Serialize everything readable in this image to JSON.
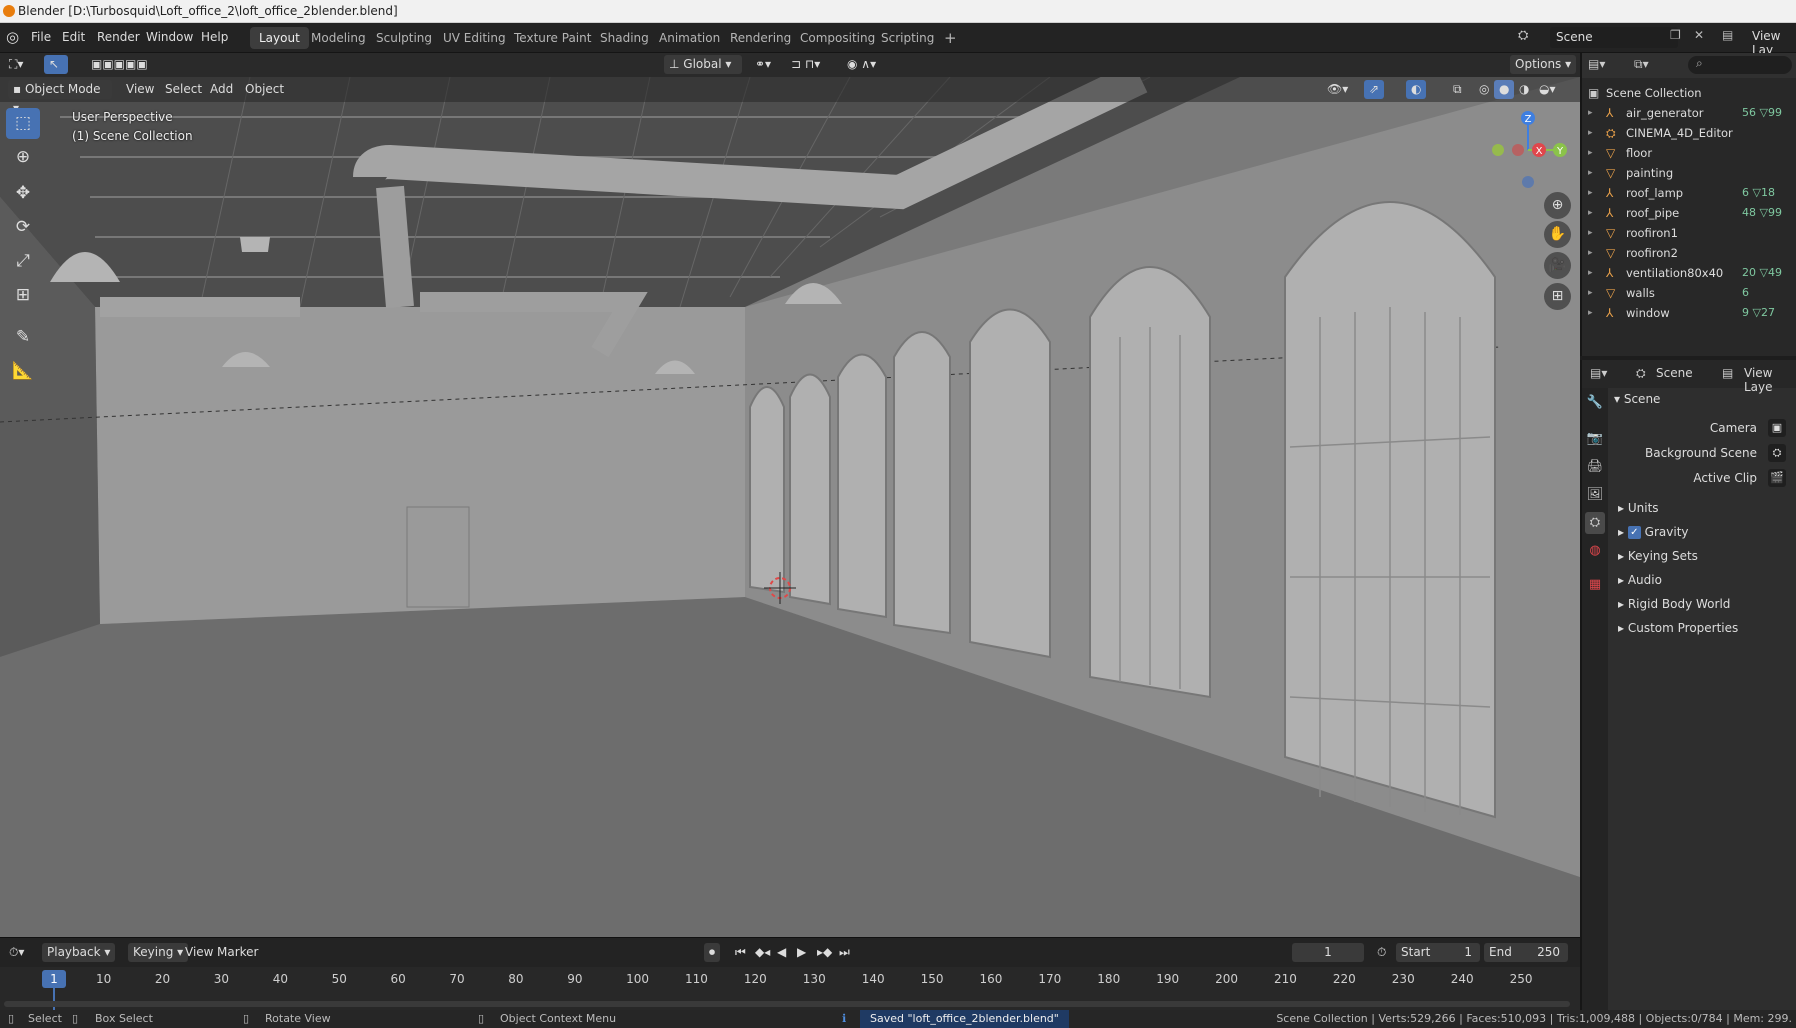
{
  "window": {
    "title": "Blender [D:\\Turbosquid\\Loft_office_2\\loft_office_2blender.blend]"
  },
  "menu": [
    "File",
    "Edit",
    "Render",
    "Window",
    "Help"
  ],
  "workspaces": [
    {
      "label": "Layout",
      "active": true
    },
    {
      "label": "Modeling"
    },
    {
      "label": "Sculpting"
    },
    {
      "label": "UV Editing"
    },
    {
      "label": "Texture Paint"
    },
    {
      "label": "Shading"
    },
    {
      "label": "Animation"
    },
    {
      "label": "Rendering"
    },
    {
      "label": "Compositing"
    },
    {
      "label": "Scripting"
    }
  ],
  "scene_selector": {
    "label": "Scene"
  },
  "view_layer_selector": {
    "label": "View Lay"
  },
  "viewport_header": {
    "orientation": "Global",
    "options": "Options",
    "mode": "Object Mode",
    "menus": [
      "View",
      "Select",
      "Add",
      "Object"
    ]
  },
  "viewport_overlay": {
    "line1": "User Perspective",
    "line2": "(1) Scene Collection"
  },
  "gizmo_axes": {
    "x": "X",
    "y": "Y",
    "z": "Z"
  },
  "outliner": {
    "root": "Scene Collection",
    "items": [
      {
        "name": "air_generator",
        "extra": "56 ▽99"
      },
      {
        "name": "CINEMA_4D_Editor",
        "extra": ""
      },
      {
        "name": "floor",
        "extra": ""
      },
      {
        "name": "painting",
        "extra": ""
      },
      {
        "name": "roof_lamp",
        "extra": "6 ▽18"
      },
      {
        "name": "roof_pipe",
        "extra": "48 ▽99"
      },
      {
        "name": "roofiron1",
        "extra": ""
      },
      {
        "name": "roofiron2",
        "extra": ""
      },
      {
        "name": "ventilation80x40",
        "extra": "20 ▽49"
      },
      {
        "name": "walls",
        "extra": "6"
      },
      {
        "name": "window",
        "extra": "9 ▽27"
      }
    ]
  },
  "properties": {
    "header_scene": "Scene",
    "header_view_layer": "View Laye",
    "panel_title": "Scene",
    "fields": [
      {
        "label": "Camera"
      },
      {
        "label": "Background Scene"
      },
      {
        "label": "Active Clip"
      }
    ],
    "sections": [
      {
        "label": "Units"
      },
      {
        "label": "Gravity",
        "checked": true
      },
      {
        "label": "Keying Sets"
      },
      {
        "label": "Audio"
      },
      {
        "label": "Rigid Body World"
      },
      {
        "label": "Custom Properties"
      }
    ]
  },
  "timeline": {
    "menus": [
      "Playback",
      "Keying",
      "View",
      "Marker"
    ],
    "current_frame": "1",
    "start_label": "Start",
    "start": "1",
    "end_label": "End",
    "end": "250",
    "ticks": [
      "10",
      "20",
      "30",
      "40",
      "50",
      "60",
      "70",
      "80",
      "90",
      "100",
      "110",
      "120",
      "130",
      "140",
      "150",
      "160",
      "170",
      "180",
      "190",
      "200",
      "210",
      "220",
      "230",
      "240",
      "250"
    ]
  },
  "statusbar": {
    "select": "Select",
    "box_select": "Box Select",
    "rotate_view": "Rotate View",
    "context_menu": "Object Context Menu",
    "message": "Saved \"loft_office_2blender.blend\"",
    "stats": "Scene Collection | Verts:529,266 | Faces:510,093 | Tris:1,009,488 | Objects:0/784 | Mem: 299."
  },
  "colors": {
    "accent": "#4772b3",
    "viewport_bg": "#7a7a7a",
    "ui_dark": "#232323",
    "axis_x": "#e0474c",
    "axis_y": "#8bc34a",
    "axis_z": "#3f7fe0"
  },
  "icons": [
    "blender-icon",
    "editor-type-icon",
    "select-box-icon",
    "cursor-icon",
    "move-icon",
    "rotate-icon",
    "scale-icon",
    "transform-icon",
    "annotate-icon",
    "measure-icon",
    "zoom-icon",
    "hand-icon",
    "camera-icon",
    "grid-icon",
    "search-icon",
    "play-icon",
    "record-icon"
  ]
}
